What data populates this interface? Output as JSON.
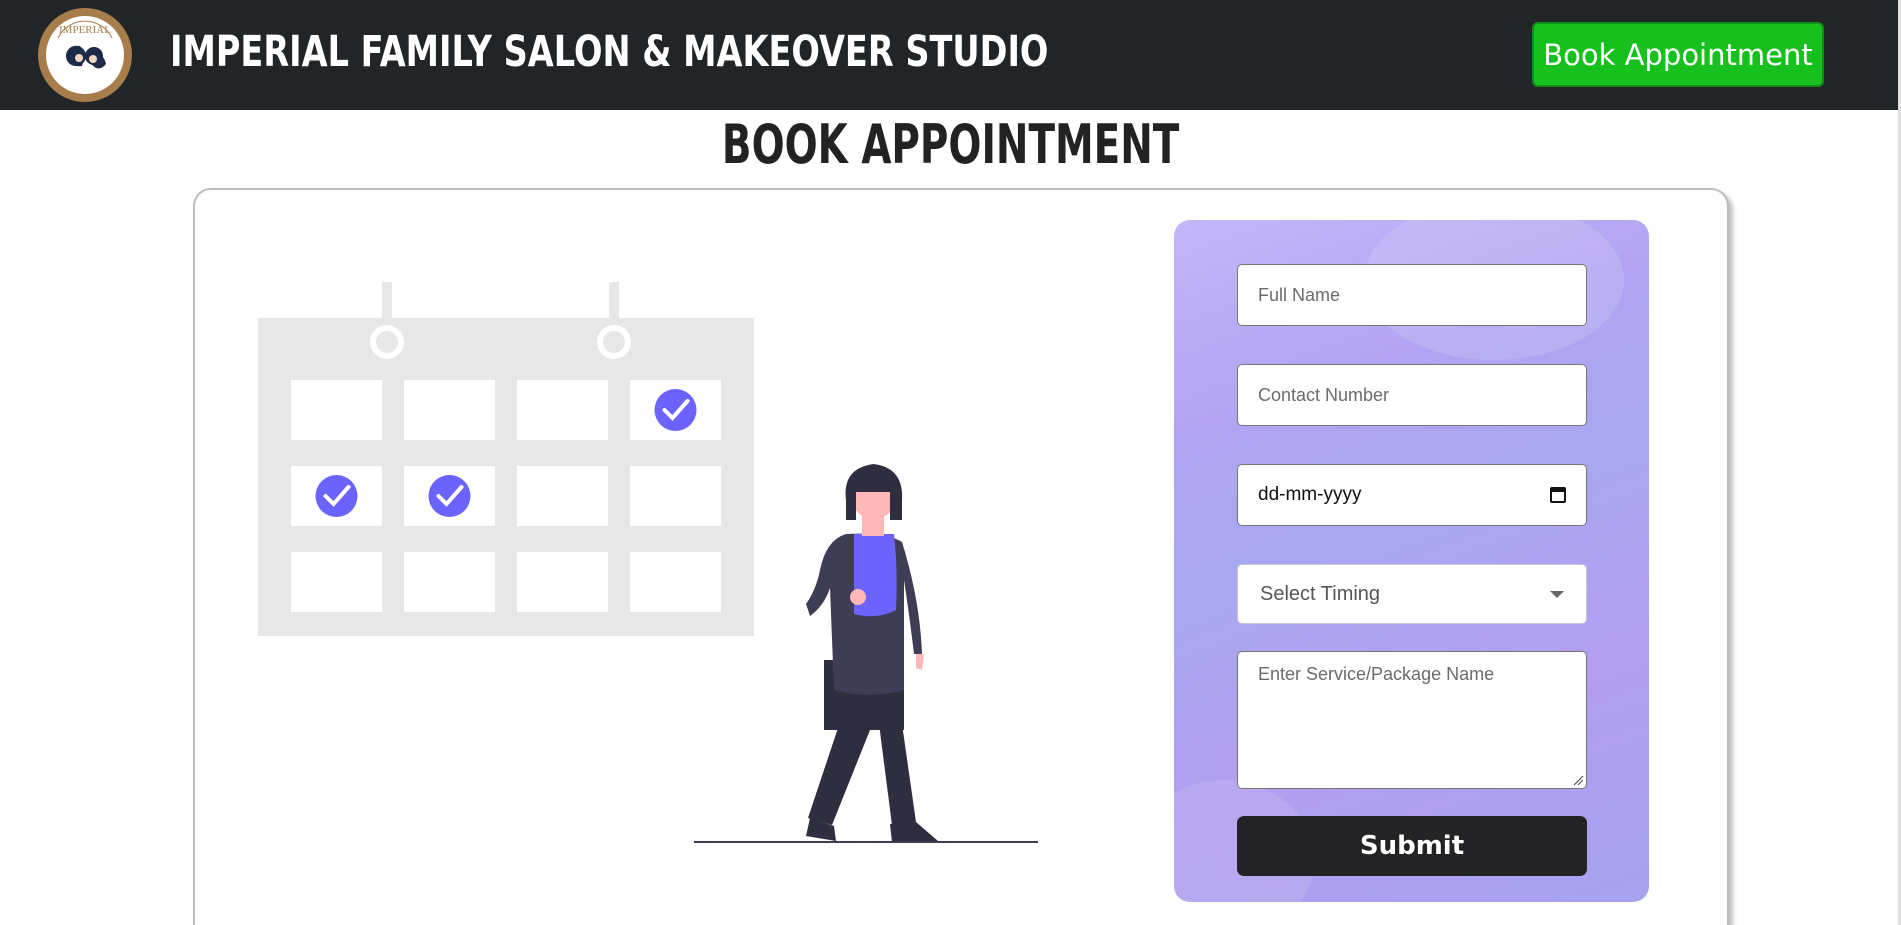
{
  "header": {
    "logo_text": "IMPERIAL",
    "logo_subtext": "Family Salon & Makeover Studio",
    "brand_title": "IMPERIAL FAMILY SALON & MAKEOVER STUDIO",
    "cta_label": "Book Appointment"
  },
  "main": {
    "page_title": "BOOK APPOINTMENT"
  },
  "form": {
    "full_name_placeholder": "Full Name",
    "contact_placeholder": "Contact Number",
    "date_value": "dd-mm-yyyy",
    "timing_selected": "Select Timing",
    "service_placeholder": "Enter Service/Package Name",
    "submit_label": "Submit"
  },
  "illustration": {
    "calendar_checked": [
      [
        false,
        false,
        false,
        true
      ],
      [
        true,
        true,
        false,
        false
      ],
      [
        false,
        false,
        false,
        false
      ]
    ]
  },
  "colors": {
    "header_bg": "#222528",
    "cta_green": "#16c11d",
    "check_purple": "#6c63ff",
    "calendar_gray": "#e6e7e6",
    "submit_dark": "#232224"
  }
}
